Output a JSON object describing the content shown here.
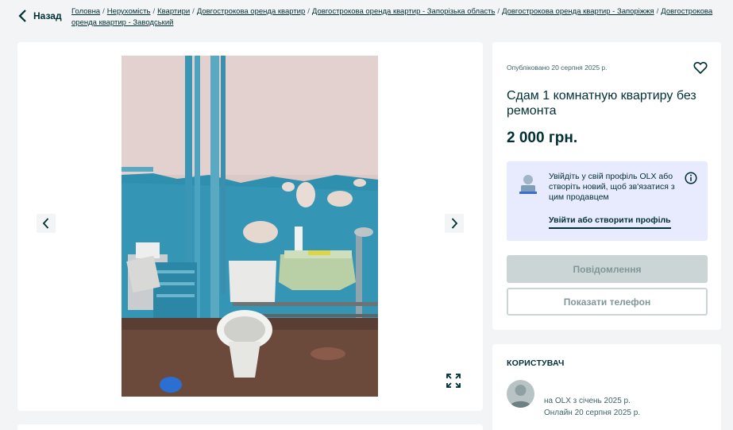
{
  "back": {
    "label": "Назад"
  },
  "breadcrumbs": [
    "Головна",
    "Нерухомість",
    "Квартири",
    "Довгострокова оренда квартир",
    "Довгострокова оренда квартир - Запорізька область",
    "Довгострокова оренда квартир - Запоріжжя",
    "Довгострокова оренда квартир - Заводський"
  ],
  "listing": {
    "published": "Опубліковано 20 серпня 2025 р.",
    "title": "Сдам 1 комнатную квартиру без ремонта",
    "price": "2 000 грн."
  },
  "login_prompt": {
    "text": "Увійдіть у свій профіль OLX або створіть новий, щоб зв'язатися з цим продавцем",
    "link": "Увійти або створити профіль"
  },
  "buttons": {
    "message": "Повідомлення",
    "show_phone": "Показати телефон"
  },
  "user": {
    "heading": "КОРИСТУВАЧ",
    "on_olx_since": "на OLX з січень 2025 р.",
    "online": "Онлайн 20 серпня 2025 р."
  },
  "icons": {
    "back": "chevron-left-icon",
    "prev": "chevron-left-icon",
    "next": "chevron-right-icon",
    "expand": "expand-icon",
    "favorite": "heart-icon",
    "info": "info-icon"
  },
  "colors": {
    "text": "#002f34",
    "background": "#f2f4f5",
    "login_box": "#e8ebfd",
    "disabled_button": "#ccd5d6"
  }
}
